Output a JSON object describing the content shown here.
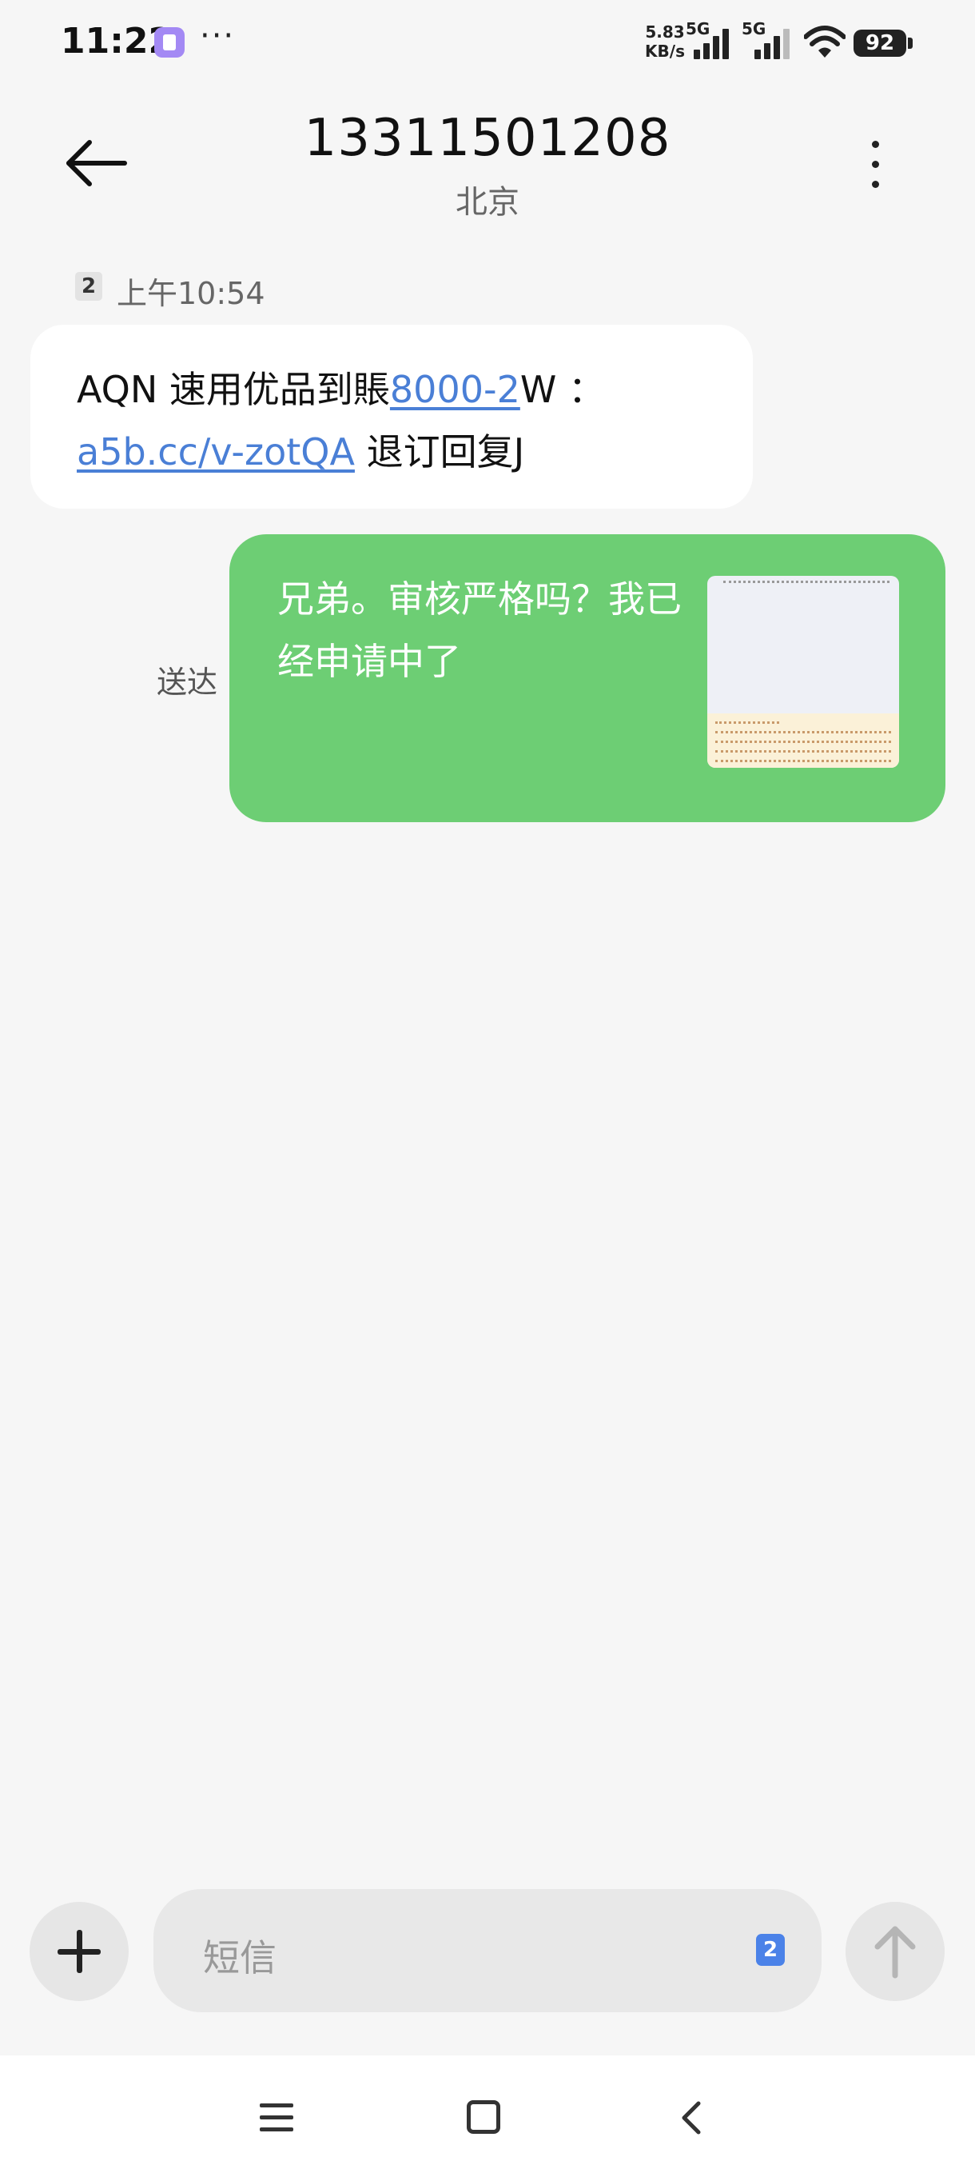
{
  "status_bar": {
    "time": "11:22",
    "more": "···",
    "net_speed_value": "5.83",
    "net_speed_unit": "KB/s",
    "network_1": "5G",
    "network_2": "5G",
    "battery": "92"
  },
  "header": {
    "contact_number": "13311501208",
    "location": "北京"
  },
  "messages": {
    "sim_badge": "2",
    "timestamp": "上午10:54",
    "incoming": {
      "text_before": "AQN 速用优品到賬",
      "link_amount": "8000-2",
      "text_after": "W ：",
      "link_url": "a5b.cc/v-zotQA",
      "text_end": "退订回复J"
    },
    "outgoing": {
      "status": "送达",
      "text": "兄弟。审核严格吗？我已经申请中了"
    }
  },
  "composer": {
    "placeholder": "短信",
    "sim_badge": "2"
  },
  "icons": {
    "back": "arrow-left-icon",
    "more": "more-vertical-icon",
    "attach": "plus-icon",
    "send": "arrow-up-icon",
    "nav_menu": "menu-icon",
    "nav_home": "home-square-icon",
    "nav_back": "chevron-left-icon"
  },
  "colors": {
    "outgoing_bubble": "#6dce74",
    "link": "#4a7fd6",
    "sim_select": "#4b82e8",
    "background": "#f6f6f6"
  }
}
